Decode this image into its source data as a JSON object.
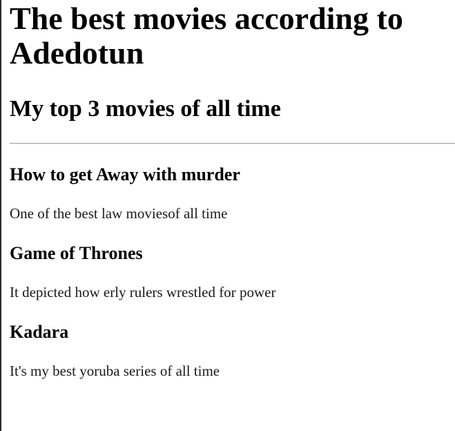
{
  "page": {
    "title": "The best movies according to Adedotun",
    "subtitle": "My top 3 movies of all time"
  },
  "movies": [
    {
      "name": "How to get Away with murder",
      "description": "One of the best law moviesof all time"
    },
    {
      "name": "Game of Thrones",
      "description": "It depicted how erly rulers wrestled for power"
    },
    {
      "name": "Kadara",
      "description": "It's my best yoruba series of all time"
    }
  ]
}
